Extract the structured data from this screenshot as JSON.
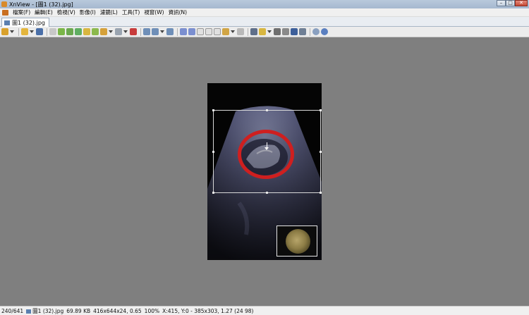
{
  "window": {
    "title": "XnView - [圖1 (32).jpg]",
    "buttons": {
      "minimize": "–",
      "maximize": "□",
      "close": "✕"
    }
  },
  "menu": {
    "items": [
      "檔案(F)",
      "編輯(E)",
      "檢視(V)",
      "影像(I)",
      "濾鏡(L)",
      "工具(T)",
      "視窗(W)",
      "資訊(N)"
    ]
  },
  "tab": {
    "label": "圖1 (32).jpg"
  },
  "toolbar": {
    "icons": [
      "browser-icon",
      "open-folder-icon",
      "save-icon",
      "print-preview-icon",
      "color-icon",
      "acquire-icon",
      "slideshow-icon",
      "convert-icon",
      "rename-icon",
      "capture-icon",
      "properties-icon",
      "zoom-in-icon",
      "zoom-fit-icon",
      "zoom-out-icon",
      "prev-icon",
      "next-icon",
      "first-page-icon",
      "last-page-icon",
      "fullscreen-icon",
      "copy-icon",
      "paste-icon",
      "crop-icon",
      "adjust-icon",
      "find-icon",
      "print-icon",
      "screen-icon",
      "exit-icon",
      "options-icon",
      "help-icon"
    ]
  },
  "status": {
    "index": "240/641",
    "filename": "圖1 (32).jpg",
    "filesize": "69.89 KB",
    "dimensions": "416x644x24, 0.65",
    "zoom": "100%",
    "cursor": "X:415, Y:0 - 385x303, 1.27 (24 98)"
  },
  "colors": {
    "background": "#7f7f7f",
    "annotation_circle": "#cf1f1f"
  }
}
